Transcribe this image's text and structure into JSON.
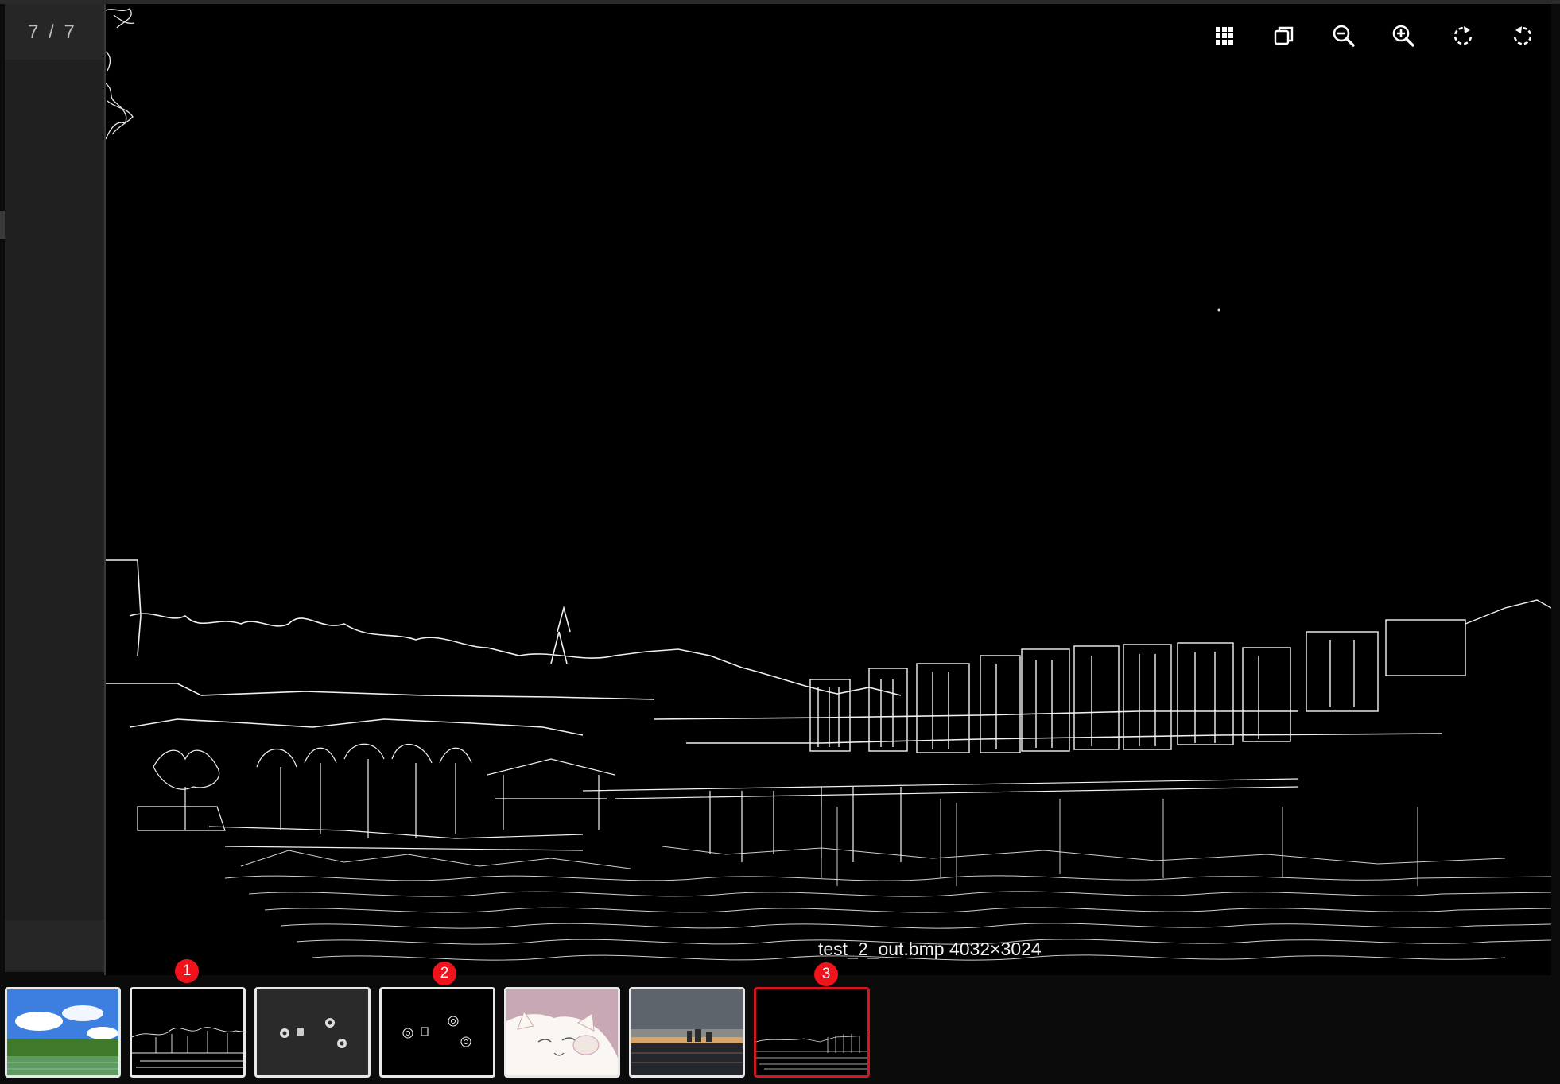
{
  "viewer": {
    "counter": "7 / 7",
    "caption": "test_2_out.bmp 4032×3024"
  },
  "toolbar": {
    "items": [
      {
        "name": "thumbnails-grid-button",
        "icon": "grid-icon"
      },
      {
        "name": "actual-size-button",
        "icon": "copy-icon"
      },
      {
        "name": "zoom-out-button",
        "icon": "zoom-out-icon"
      },
      {
        "name": "zoom-in-button",
        "icon": "zoom-in-icon"
      },
      {
        "name": "rotate-right-button",
        "icon": "rotate-right-icon"
      },
      {
        "name": "rotate-left-button",
        "icon": "rotate-left-icon"
      }
    ]
  },
  "thumbnails": [
    {
      "name": "thumbnail-1",
      "style": "landscape-photo",
      "active": false
    },
    {
      "name": "thumbnail-2",
      "style": "edge-landscape",
      "active": false
    },
    {
      "name": "thumbnail-3",
      "style": "nuts-photo",
      "active": false
    },
    {
      "name": "thumbnail-4",
      "style": "edge-nuts",
      "active": false
    },
    {
      "name": "thumbnail-5",
      "style": "cat-drawing",
      "active": false
    },
    {
      "name": "thumbnail-6",
      "style": "dusk-photo",
      "active": false
    },
    {
      "name": "thumbnail-7",
      "style": "edge-dusk",
      "active": true
    }
  ],
  "badges": [
    {
      "label": "1"
    },
    {
      "label": "2"
    },
    {
      "label": "3"
    }
  ],
  "colors": {
    "accent": "#d4161f",
    "badge": "#f0131b",
    "panel": "#202020"
  }
}
